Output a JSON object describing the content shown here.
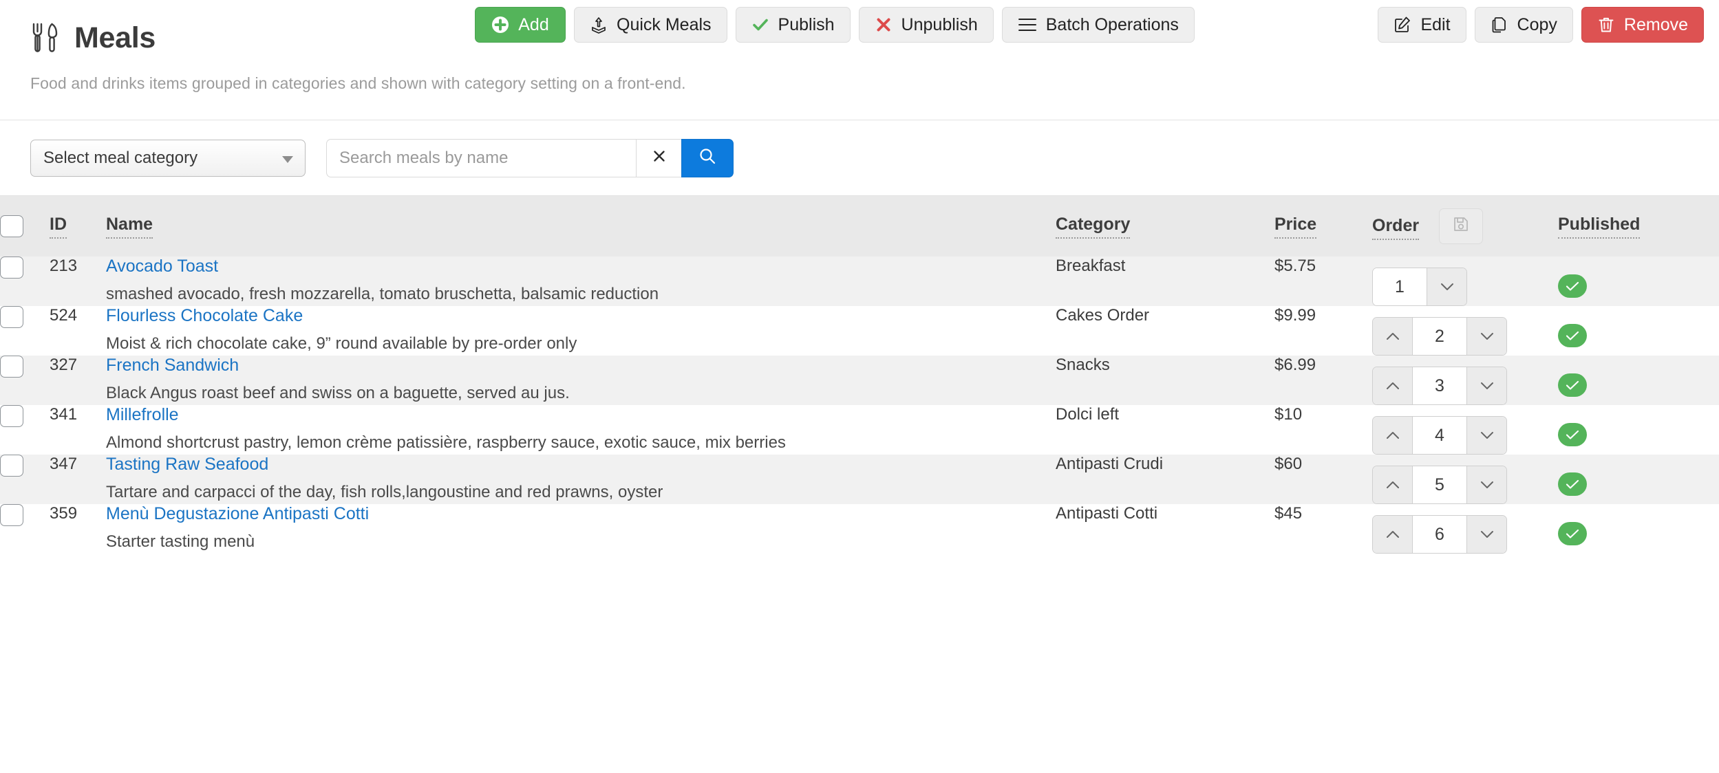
{
  "header": {
    "icon": "fork-knife-icon",
    "title": "Meals",
    "subtitle": "Food and drinks items grouped in categories and shown with category setting on a front-end."
  },
  "toolbar": {
    "buttons": [
      {
        "label": "Add",
        "icon": "plus-circle-icon",
        "style": "green"
      },
      {
        "label": "Quick Meals",
        "icon": "upload-icon",
        "style": "default"
      },
      {
        "label": "Publish",
        "icon": "check-icon",
        "style": "default"
      },
      {
        "label": "Unpublish",
        "icon": "x-icon",
        "style": "default"
      },
      {
        "label": "Batch Operations",
        "icon": "hamburger-icon",
        "style": "default"
      },
      {
        "label": "Edit",
        "icon": "pencil-square-icon",
        "style": "default"
      },
      {
        "label": "Copy",
        "icon": "copy-icon",
        "style": "default"
      },
      {
        "label": "Remove",
        "icon": "trash-icon",
        "style": "red"
      }
    ]
  },
  "filters": {
    "category_select": {
      "selected": "Select meal category",
      "options": [
        "Select meal category"
      ]
    },
    "search": {
      "value": "",
      "placeholder": "Search meals by name",
      "clear_icon": "close-icon",
      "submit_icon": "search-icon"
    }
  },
  "table": {
    "columns": [
      {
        "key": "check",
        "label": "",
        "sortable": false
      },
      {
        "key": "id",
        "label": "ID",
        "sortable": true
      },
      {
        "key": "name",
        "label": "Name",
        "sortable": true
      },
      {
        "key": "category",
        "label": "Category",
        "sortable": true
      },
      {
        "key": "price",
        "label": "Price",
        "sortable": true
      },
      {
        "key": "order",
        "label": "Order",
        "sortable": true
      },
      {
        "key": "published",
        "label": "Published",
        "sortable": true
      }
    ],
    "save_order_icon": "floppy-disk-icon",
    "rows": [
      {
        "id": "213",
        "name": "Avocado Toast",
        "description": "smashed avocado, fresh mozzarella, tomato bruschetta, balsamic reduction",
        "category": "Breakfast",
        "price": "$5.75",
        "order": "1",
        "has_up": false,
        "has_down": true,
        "published": true,
        "selected": false
      },
      {
        "id": "524",
        "name": "Flourless Chocolate Cake",
        "description": "Moist & rich chocolate cake, 9” round available by pre-order only",
        "category": "Cakes Order",
        "price": "$9.99",
        "order": "2",
        "has_up": true,
        "has_down": true,
        "published": true,
        "selected": false
      },
      {
        "id": "327",
        "name": "French Sandwich",
        "description": "Black Angus roast beef and swiss on a baguette, served au jus.",
        "category": "Snacks",
        "price": "$6.99",
        "order": "3",
        "has_up": true,
        "has_down": true,
        "published": true,
        "selected": false
      },
      {
        "id": "341",
        "name": "Millefrolle",
        "description": "Almond shortcrust pastry, lemon crème patissière, raspberry sauce, exotic sauce, mix berries",
        "category": "Dolci left",
        "price": "$10",
        "order": "4",
        "has_up": true,
        "has_down": true,
        "published": true,
        "selected": false
      },
      {
        "id": "347",
        "name": "Tasting Raw Seafood",
        "description": "Tartare and carpacci of the day, fish rolls,langoustine and red prawns, oyster",
        "category": "Antipasti Crudi",
        "price": "$60",
        "order": "5",
        "has_up": true,
        "has_down": true,
        "published": true,
        "selected": false
      },
      {
        "id": "359",
        "name": "Menù Degustazione Antipasti Cotti",
        "description": "Starter tasting menù",
        "category": "Antipasti Cotti",
        "price": "$45",
        "order": "6",
        "has_up": true,
        "has_down": true,
        "published": true,
        "selected": false
      }
    ]
  },
  "colors": {
    "accent_green": "#54b45a",
    "accent_red": "#dd5252",
    "accent_blue": "#0d7bdd",
    "link_blue": "#1b74c4",
    "header_bg": "#e9e9e9",
    "stripe_bg": "#f1f1f1"
  }
}
